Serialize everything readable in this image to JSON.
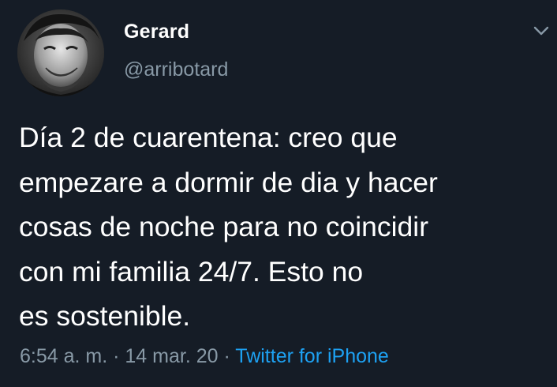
{
  "user": {
    "display_name": "Gerard",
    "handle": "@arribotard",
    "avatar_icon": "profile-photo"
  },
  "tweet": {
    "lines": [
      "Día 2 de cuarentena: creo que",
      "empezare a dormir de dia y hacer",
      "cosas de noche para no coincidir",
      "con mi familia 24/7. Esto no",
      "es sostenible."
    ]
  },
  "meta": {
    "time": "6:54 a. m.",
    "separator_1": " · ",
    "date": "14 mar. 20",
    "separator_2": " · ",
    "source": "Twitter for iPhone"
  },
  "menu": {
    "icon": "chevron-down-icon"
  },
  "colors": {
    "background": "#151c26",
    "text": "#ffffff",
    "secondary": "#8899a6",
    "link": "#1da1f2"
  }
}
